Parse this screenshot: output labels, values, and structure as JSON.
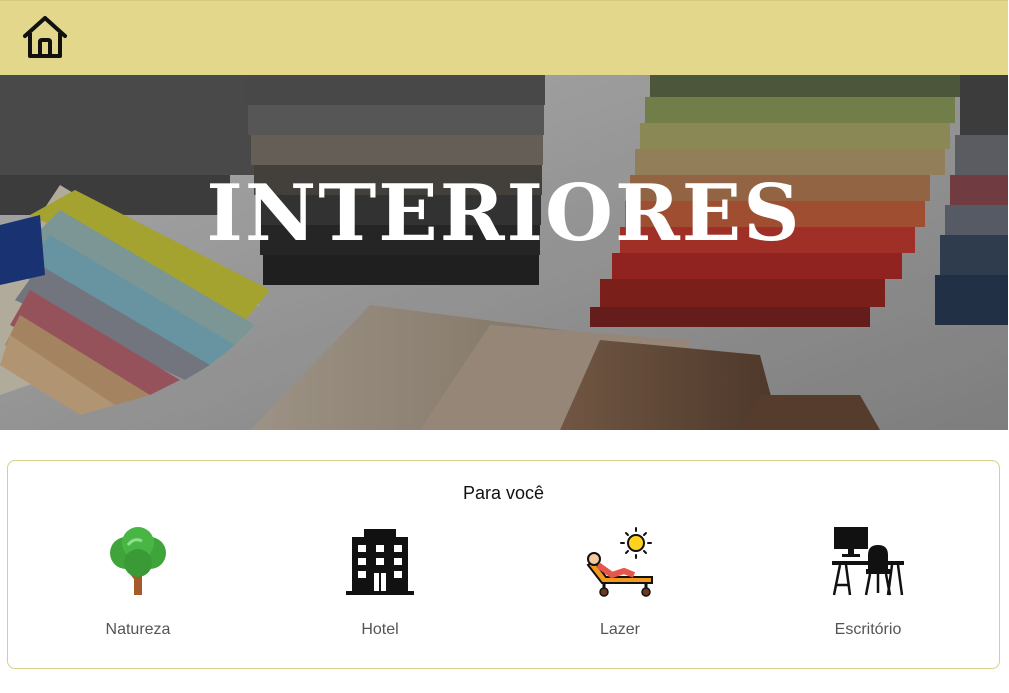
{
  "header": {
    "home_icon": "home-icon",
    "background_color": "#e2d78a"
  },
  "hero": {
    "title": "INTERIORES"
  },
  "section": {
    "title": "Para você",
    "border_color": "#d9cf8a",
    "categories": [
      {
        "label": "Natureza",
        "icon": "tree-icon"
      },
      {
        "label": "Hotel",
        "icon": "hotel-building-icon"
      },
      {
        "label": "Lazer",
        "icon": "sunbed-relax-icon"
      },
      {
        "label": "Escritório",
        "icon": "office-desk-icon"
      }
    ]
  }
}
